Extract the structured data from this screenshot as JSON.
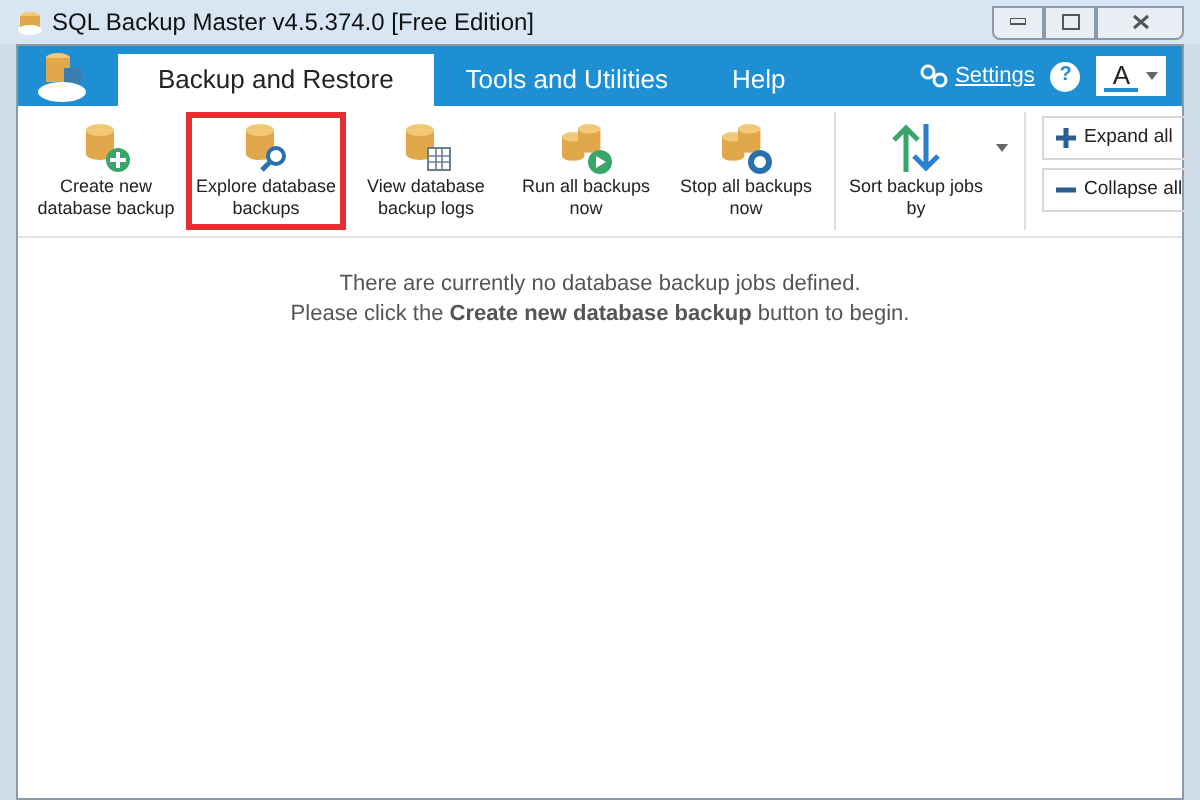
{
  "window": {
    "title": "SQL Backup Master v4.5.374.0 [Free Edition]"
  },
  "tabs": [
    {
      "label": "Backup and Restore",
      "selected": true
    },
    {
      "label": "Tools and Utilities",
      "selected": false
    },
    {
      "label": "Help",
      "selected": false
    }
  ],
  "settings_link": "Settings",
  "help_button": "?",
  "font_button": "A",
  "toolbar": [
    {
      "kind": "db-add",
      "label": "Create new database backup",
      "highlighted": false
    },
    {
      "kind": "db-search",
      "label": "Explore database backups",
      "highlighted": true
    },
    {
      "kind": "db-log",
      "label": "View database backup logs",
      "highlighted": false
    },
    {
      "kind": "db-run",
      "label": "Run all backups now",
      "highlighted": false
    },
    {
      "kind": "db-stop",
      "label": "Stop all backups now",
      "highlighted": false
    },
    {
      "kind": "sort",
      "label": "Sort backup jobs by",
      "highlighted": false,
      "dropdown": true
    }
  ],
  "side_buttons": [
    {
      "kind": "plus",
      "label": "Expand all"
    },
    {
      "kind": "minus",
      "label": "Collapse all"
    }
  ],
  "message": [
    "There are currently no database backup jobs defined.",
    "Please click the **Create new database backup** button to begin."
  ]
}
